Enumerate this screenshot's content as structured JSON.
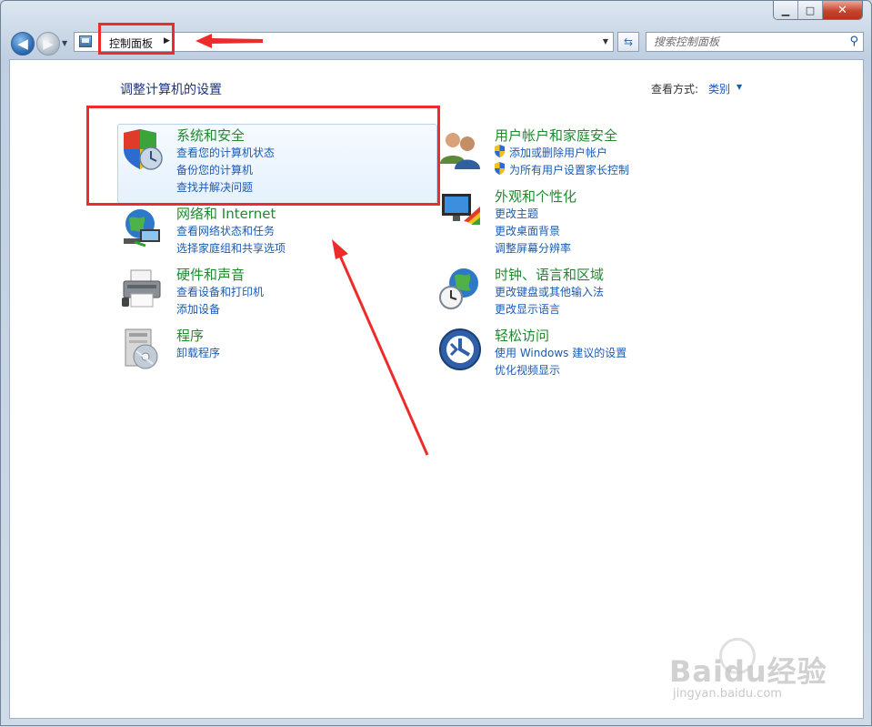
{
  "window": {
    "controls": {
      "minimize": "▁",
      "maximize": "□",
      "close": "✕"
    }
  },
  "nav": {
    "back_icon": "arrow-left-icon",
    "forward_icon": "arrow-right-icon"
  },
  "address_bar": {
    "breadcrumb": "控制面板",
    "separator_icon": "chevron-right-icon"
  },
  "search": {
    "placeholder": "搜索控制面板"
  },
  "content": {
    "title": "调整计算机的设置",
    "view_by_label": "查看方式:",
    "view_by_value": "类别"
  },
  "categories": [
    {
      "title": "系统和安全",
      "icon": "shield-security-icon",
      "links": [
        "查看您的计算机状态",
        "备份您的计算机",
        "查找并解决问题"
      ]
    },
    {
      "title": "网络和 Internet",
      "icon": "network-globe-icon",
      "links": [
        "查看网络状态和任务",
        "选择家庭组和共享选项"
      ]
    },
    {
      "title": "硬件和声音",
      "icon": "printer-hardware-icon",
      "links": [
        "查看设备和打印机",
        "添加设备"
      ]
    },
    {
      "title": "程序",
      "icon": "programs-disc-icon",
      "links": [
        "卸载程序"
      ]
    },
    {
      "title": "用户帐户和家庭安全",
      "icon": "users-icon",
      "links": [
        "添加或删除用户帐户",
        "为所有用户设置家长控制"
      ]
    },
    {
      "title": "外观和个性化",
      "icon": "monitor-palette-icon",
      "links": [
        "更改主题",
        "更改桌面背景",
        "调整屏幕分辨率"
      ]
    },
    {
      "title": "时钟、语言和区域",
      "icon": "clock-globe-icon",
      "links": [
        "更改键盘或其他输入法",
        "更改显示语言"
      ]
    },
    {
      "title": "轻松访问",
      "icon": "ease-of-access-icon",
      "links": [
        "使用 Windows 建议的设置",
        "优化视频显示"
      ]
    }
  ],
  "watermark": {
    "brand": "Baidu经验",
    "url": "jingyan.baidu.com"
  },
  "colors": {
    "link": "#1a5bb5",
    "heading": "#1f8a2e",
    "title": "#1e3287",
    "annotation": "#ee2b2b"
  }
}
